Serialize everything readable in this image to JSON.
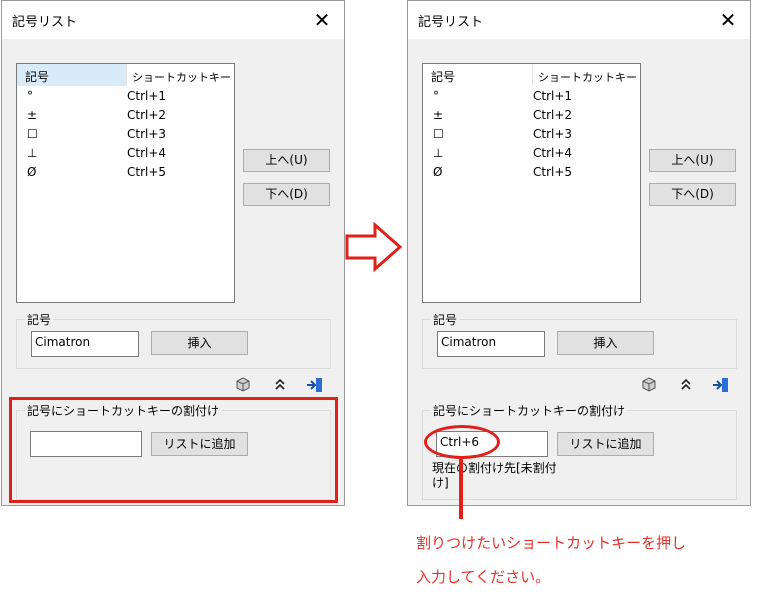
{
  "left_dialog": {
    "title": "記号リスト",
    "close": "✕",
    "list_header": {
      "symbol": "記号",
      "shortcut": "ショートカットキー"
    },
    "rows": [
      {
        "symbol": "°",
        "key": "Ctrl+1"
      },
      {
        "symbol": "±",
        "key": "Ctrl+2"
      },
      {
        "symbol": "☐",
        "key": "Ctrl+3"
      },
      {
        "symbol": "⊥",
        "key": "Ctrl+4"
      },
      {
        "symbol": "Ø",
        "key": "Ctrl+5"
      }
    ],
    "up_button": "上へ(U)",
    "down_button": "下へ(D)",
    "symbol_group_label": "記号",
    "symbol_value": "Cimatron",
    "insert_button": "挿入",
    "assign_group_label": "記号にショートカットキーの割付け",
    "shortcut_value": "",
    "add_button": "リストに追加"
  },
  "right_dialog": {
    "title": "記号リスト",
    "close": "✕",
    "list_header": {
      "symbol": "記号",
      "shortcut": "ショートカットキー"
    },
    "rows": [
      {
        "symbol": "°",
        "key": "Ctrl+1"
      },
      {
        "symbol": "±",
        "key": "Ctrl+2"
      },
      {
        "symbol": "☐",
        "key": "Ctrl+3"
      },
      {
        "symbol": "⊥",
        "key": "Ctrl+4"
      },
      {
        "symbol": "Ø",
        "key": "Ctrl+5"
      }
    ],
    "up_button": "上へ(U)",
    "down_button": "下へ(D)",
    "symbol_group_label": "記号",
    "symbol_value": "Cimatron",
    "insert_button": "挿入",
    "assign_group_label": "記号にショートカットキーの割付け",
    "shortcut_value": "Ctrl+6",
    "add_button": "リストに追加",
    "status_line1": "現在の割付け先[未割付",
    "status_line2": "け]"
  },
  "annotation": {
    "line1": "割りつけたいショートカットキーを押し",
    "line2": "入力してください。",
    "color": "#e8332b"
  },
  "icons": [
    "cube-icon",
    "double-chevron-up-icon",
    "exit-icon",
    "arrow-right-icon"
  ]
}
